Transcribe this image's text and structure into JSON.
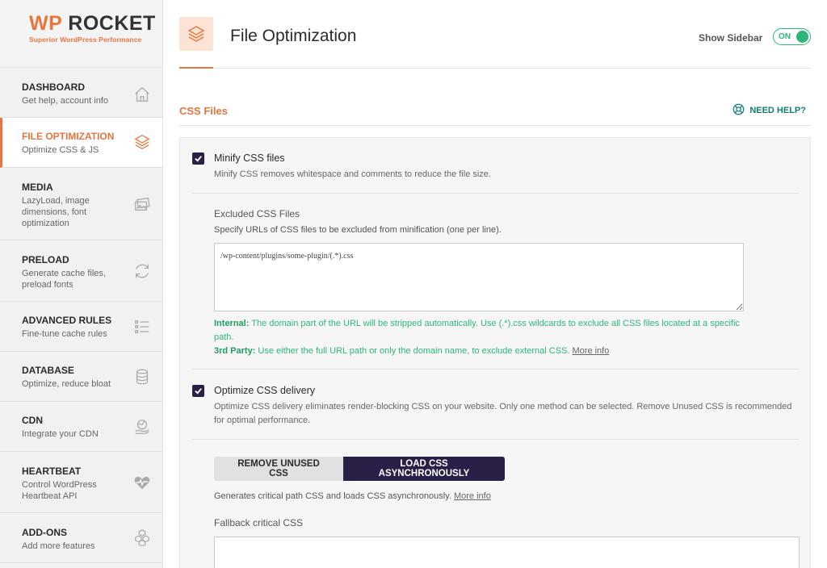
{
  "logo": {
    "main_wp": "WP",
    "main_rocket": " ROCKET",
    "tagline": "Superior WordPress Performance"
  },
  "sidebar": {
    "items": [
      {
        "title": "DASHBOARD",
        "desc": "Get help, account info",
        "icon": "home-icon"
      },
      {
        "title": "FILE OPTIMIZATION",
        "desc": "Optimize CSS & JS",
        "icon": "layers-icon",
        "active": true
      },
      {
        "title": "MEDIA",
        "desc": "LazyLoad, image dimensions, font optimization",
        "icon": "images-icon"
      },
      {
        "title": "PRELOAD",
        "desc": "Generate cache files, preload fonts",
        "icon": "refresh-icon"
      },
      {
        "title": "ADVANCED RULES",
        "desc": "Fine-tune cache rules",
        "icon": "list-icon"
      },
      {
        "title": "DATABASE",
        "desc": "Optimize, reduce bloat",
        "icon": "database-icon"
      },
      {
        "title": "CDN",
        "desc": "Integrate your CDN",
        "icon": "globe-hand-icon"
      },
      {
        "title": "HEARTBEAT",
        "desc": "Control WordPress Heartbeat API",
        "icon": "heartbeat-icon"
      },
      {
        "title": "ADD-ONS",
        "desc": "Add more features",
        "icon": "cubes-icon"
      }
    ]
  },
  "header": {
    "title": "File Optimization",
    "show_sidebar_label": "Show Sidebar",
    "toggle_label": "ON"
  },
  "section": {
    "title": "CSS Files",
    "need_help": "NEED HELP?"
  },
  "minify": {
    "label": "Minify CSS files",
    "desc": "Minify CSS removes whitespace and comments to reduce the file size.",
    "checked": true
  },
  "excluded": {
    "label": "Excluded CSS Files",
    "desc": "Specify URLs of CSS files to be excluded from minification (one per line).",
    "value": "/wp-content/plugins/some-plugin/(.*).css",
    "internal_label": "Internal:",
    "internal_text": " The domain part of the URL will be stripped automatically. Use (.*).css wildcards to exclude all CSS files located at a specific path.",
    "third_label": "3rd Party:",
    "third_text": " Use either the full URL path or only the domain name, to exclude external CSS. ",
    "more_info": "More info"
  },
  "delivery": {
    "label": "Optimize CSS delivery",
    "desc": "Optimize CSS delivery eliminates render-blocking CSS on your website. Only one method can be selected. Remove Unused CSS is recommended for optimal performance.",
    "checked": true,
    "btn_remove": "REMOVE UNUSED CSS",
    "btn_async": "LOAD CSS ASYNCHRONOUSLY",
    "async_desc": "Generates critical path CSS and loads CSS asynchronously. ",
    "more_info": "More info",
    "fallback_label": "Fallback critical CSS",
    "fallback_value": ""
  }
}
